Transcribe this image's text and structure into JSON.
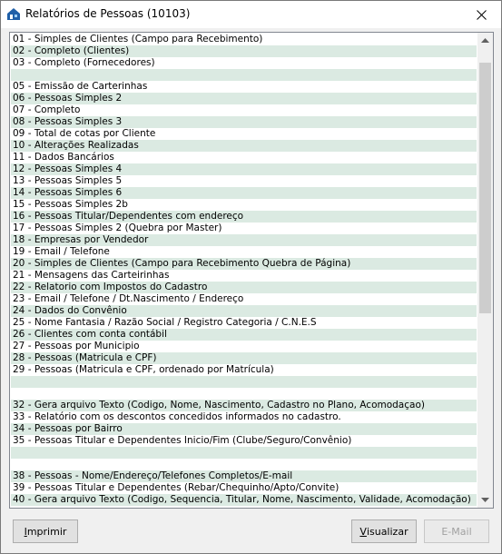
{
  "window": {
    "title": "Relatórios de Pessoas (10103)"
  },
  "list": {
    "items": [
      {
        "label": "01 - Simples de Clientes (Campo para Recebimento)"
      },
      {
        "label": "02 - Completo (Clientes)"
      },
      {
        "label": "03 - Completo (Fornecedores)"
      },
      {
        "label": ""
      },
      {
        "label": "05 - Emissão de Carterinhas"
      },
      {
        "label": "06 - Pessoas Simples 2"
      },
      {
        "label": "07 - Completo"
      },
      {
        "label": "08 - Pessoas Simples 3"
      },
      {
        "label": "09 - Total de cotas por Cliente"
      },
      {
        "label": "10 - Alterações Realizadas"
      },
      {
        "label": "11 - Dados Bancários"
      },
      {
        "label": "12 - Pessoas Simples 4"
      },
      {
        "label": "13 - Pessoas Simples 5"
      },
      {
        "label": "14 - Pessoas Simples 6"
      },
      {
        "label": "15 - Pessoas Simples 2b"
      },
      {
        "label": "16 - Pessoas Titular/Dependentes com endereço"
      },
      {
        "label": "17 - Pessoas Simples 2 (Quebra por Master)"
      },
      {
        "label": "18 - Empresas por Vendedor"
      },
      {
        "label": "19 - Email / Telefone"
      },
      {
        "label": "20 - Simples de Clientes (Campo para Recebimento Quebra de Página)"
      },
      {
        "label": "21 - Mensagens das Carteirinhas"
      },
      {
        "label": "22 - Relatorio com Impostos do Cadastro"
      },
      {
        "label": "23 - Email / Telefone / Dt.Nascimento / Endereço"
      },
      {
        "label": "24 - Dados do Convênio"
      },
      {
        "label": "25 - Nome Fantasia / Razão Social / Registro Categoria / C.N.E.S"
      },
      {
        "label": "26 - Clientes com conta contábil"
      },
      {
        "label": "27 - Pessoas por Municipio"
      },
      {
        "label": "28 - Pessoas (Matricula e CPF)"
      },
      {
        "label": "29 - Pessoas (Matricula e CPF, ordenado por Matrícula)"
      },
      {
        "label": ""
      },
      {
        "label": ""
      },
      {
        "label": "32 - Gera arquivo Texto (Codigo, Nome, Nascimento, Cadastro no Plano, Acomodaçao)"
      },
      {
        "label": "33 - Relatório com os descontos concedidos informados no cadastro."
      },
      {
        "label": "34 - Pessoas por Bairro"
      },
      {
        "label": "35 - Pessoas Titular e Dependentes Inicio/Fim (Clube/Seguro/Convênio)"
      },
      {
        "label": ""
      },
      {
        "label": ""
      },
      {
        "label": "38 - Pessoas - Nome/Endereço/Telefones Completos/E-mail"
      },
      {
        "label": "39 - Pessoas Titular e Dependentes (Rebar/Chequinho/Apto/Convite)"
      },
      {
        "label": "40 - Gera arquivo Texto (Codigo, Sequencia, Titular, Nome, Nascimento, Validade, Acomodação)"
      }
    ]
  },
  "buttons": {
    "print": {
      "accel": "I",
      "rest": "mprimir"
    },
    "view": {
      "accel": "V",
      "rest": "isualizar"
    },
    "email": {
      "label": "E-Mail"
    }
  },
  "colors": {
    "row_alt": "#dbeae2",
    "icon_blue": "#1f5fa8"
  }
}
